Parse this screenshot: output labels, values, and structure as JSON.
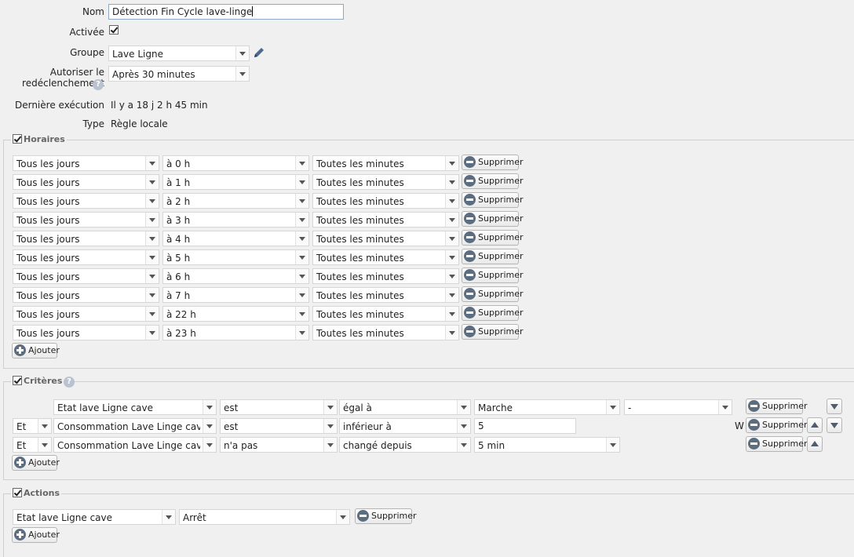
{
  "form": {
    "name_label": "Nom",
    "name_value": "Détection Fin Cycle lave-linge",
    "active_label": "Activée",
    "active_checked": true,
    "group_label": "Groupe",
    "group_value": "Lave Ligne",
    "retrigger_label_line1": "Autoriser le",
    "retrigger_label_line2": "redéclenchement",
    "retrigger_value": "Après 30 minutes",
    "last_exec_label": "Dernière exécution",
    "last_exec_value": "Il y a 18 j 2 h 45 min",
    "type_label": "Type",
    "type_value": "Règle locale"
  },
  "schedules": {
    "legend": "Horaires",
    "rows": [
      {
        "days": "Tous les jours",
        "hour": "à 0 h",
        "minutes": "Toutes les minutes"
      },
      {
        "days": "Tous les jours",
        "hour": "à 1 h",
        "minutes": "Toutes les minutes"
      },
      {
        "days": "Tous les jours",
        "hour": "à 2 h",
        "minutes": "Toutes les minutes"
      },
      {
        "days": "Tous les jours",
        "hour": "à 3 h",
        "minutes": "Toutes les minutes"
      },
      {
        "days": "Tous les jours",
        "hour": "à 4 h",
        "minutes": "Toutes les minutes"
      },
      {
        "days": "Tous les jours",
        "hour": "à 5 h",
        "minutes": "Toutes les minutes"
      },
      {
        "days": "Tous les jours",
        "hour": "à 6 h",
        "minutes": "Toutes les minutes"
      },
      {
        "days": "Tous les jours",
        "hour": "à 7 h",
        "minutes": "Toutes les minutes"
      },
      {
        "days": "Tous les jours",
        "hour": "à 22 h",
        "minutes": "Toutes les minutes"
      },
      {
        "days": "Tous les jours",
        "hour": "à 23 h",
        "minutes": "Toutes les minutes"
      }
    ],
    "delete_label": "Supprimer",
    "add_label": "Ajouter"
  },
  "criteria": {
    "legend": "Critères",
    "rows": [
      {
        "conj": "",
        "device": "Etat lave Ligne cave",
        "verb": "est",
        "op": "égal à",
        "value": "Marche",
        "extra": "-",
        "unit": ""
      },
      {
        "conj": "Et",
        "device": "Consommation Lave Linge cave",
        "verb": "est",
        "op": "inférieur à",
        "value": "5",
        "extra": "",
        "unit": "W"
      },
      {
        "conj": "Et",
        "device": "Consommation Lave Linge cave",
        "verb": "n'a pas",
        "op": "changé depuis",
        "value": "5 min",
        "extra": "",
        "unit": ""
      }
    ],
    "delete_label": "Supprimer",
    "add_label": "Ajouter"
  },
  "actions": {
    "legend": "Actions",
    "rows": [
      {
        "device": "Etat lave Ligne cave",
        "value": "Arrêt"
      }
    ],
    "delete_label": "Supprimer",
    "add_label": "Ajouter"
  }
}
